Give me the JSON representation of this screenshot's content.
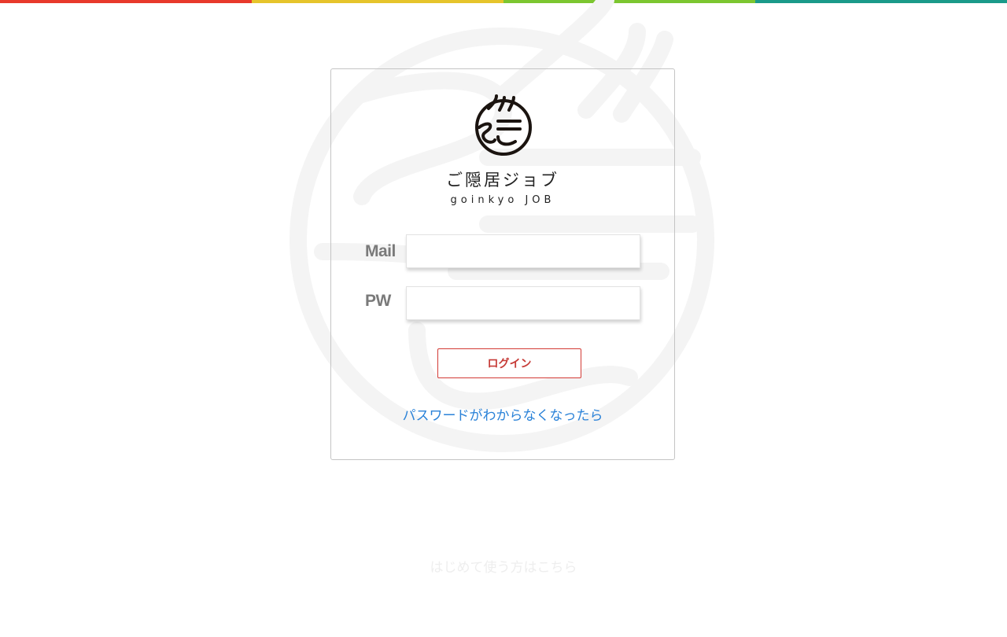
{
  "colors": {
    "top_bar": [
      "#e8392b",
      "#e6c42b",
      "#7cc630",
      "#1a9a8a"
    ],
    "accent_red": "#c63b37",
    "link_blue": "#2a82d8",
    "watermark": "#f4f4f4"
  },
  "brand": {
    "name_jp": "ご隠居ジョブ",
    "name_en": "goinkyo JOB",
    "logo_icon": "goinkyo-circle-logo"
  },
  "form": {
    "mail_label": "Mail",
    "mail_value": "",
    "pw_label": "PW",
    "pw_value": "",
    "login_label": "ログイン"
  },
  "links": {
    "forgot_password": "パスワードがわからなくなったら",
    "first_time": "はじめて使う方はこちら"
  }
}
